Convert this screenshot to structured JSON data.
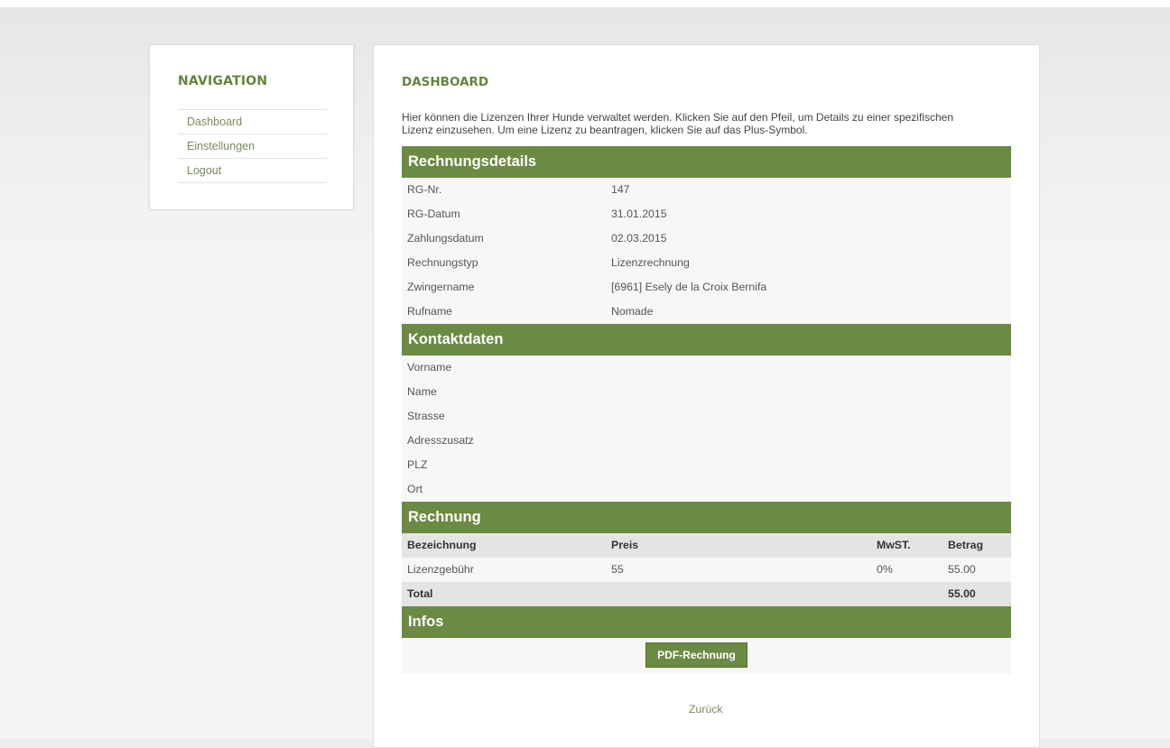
{
  "navigation": {
    "title": "NAVIGATION",
    "items": [
      {
        "label": "Dashboard"
      },
      {
        "label": "Einstellungen"
      },
      {
        "label": "Logout"
      }
    ]
  },
  "main": {
    "title": "DASHBOARD",
    "intro_line1": "Hier können die Lizenzen Ihrer Hunde verwaltet werden. Klicken Sie auf den Pfeil, um Details zu einer spezifischen",
    "intro_line2": "Lizenz einzusehen. Um eine Lizenz zu beantragen, klicken Sie auf das Plus-Symbol."
  },
  "rechnungsdetails": {
    "header": "Rechnungsdetails",
    "rows": [
      {
        "key": "RG-Nr.",
        "value": "147"
      },
      {
        "key": "RG-Datum",
        "value": "31.01.2015"
      },
      {
        "key": "Zahlungsdatum",
        "value": "02.03.2015"
      },
      {
        "key": "Rechnungstyp",
        "value": "Lizenzrechnung"
      },
      {
        "key": "Zwingername",
        "value": "[6961] Esely de la Croix Bernifa"
      },
      {
        "key": "Rufname",
        "value": "Nomade"
      }
    ]
  },
  "kontaktdaten": {
    "header": "Kontaktdaten",
    "rows": [
      {
        "key": "Vorname",
        "value": ""
      },
      {
        "key": "Name",
        "value": ""
      },
      {
        "key": "Strasse",
        "value": ""
      },
      {
        "key": "Adresszusatz",
        "value": ""
      },
      {
        "key": "PLZ",
        "value": ""
      },
      {
        "key": "Ort",
        "value": ""
      }
    ]
  },
  "rechnung": {
    "header": "Rechnung",
    "columns": [
      "Bezeichnung",
      "Preis",
      "MwST.",
      "Betrag"
    ],
    "rows": [
      {
        "bezeichnung": "Lizenzgebühr",
        "preis": "55",
        "mwst": "0%",
        "betrag": "55.00"
      }
    ],
    "total_label": "Total",
    "total_value": "55.00"
  },
  "infos": {
    "header": "Infos",
    "pdf_button": "PDF-Rechnung"
  },
  "back_link": "Zurück",
  "colors": {
    "accent": "#6b8a43",
    "heading": "#66833e",
    "link": "#7a8a5f"
  }
}
